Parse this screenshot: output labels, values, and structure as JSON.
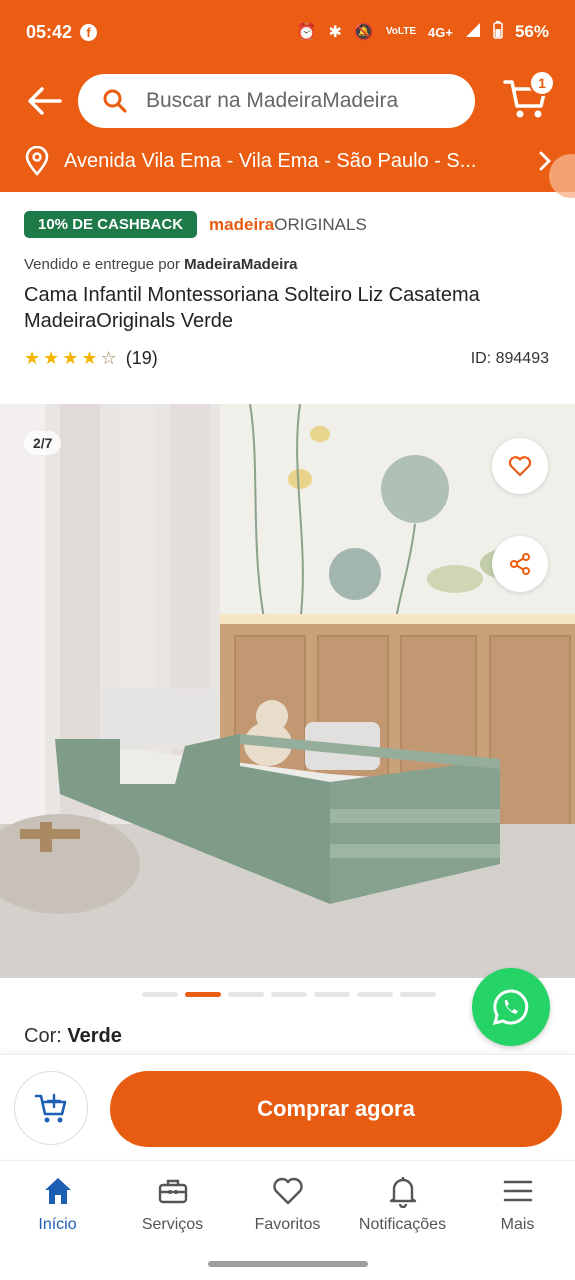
{
  "status_bar": {
    "time": "05:42",
    "network": "4G+",
    "volte": "VoLTE",
    "battery": "56%"
  },
  "search": {
    "placeholder": "Buscar na MadeiraMadeira"
  },
  "cart": {
    "count": "1"
  },
  "address": {
    "text": "Avenida Vila Ema - Vila Ema - São Paulo - S..."
  },
  "product": {
    "cashback_badge": "10% DE CASHBACK",
    "brand_bold": "madeira",
    "brand_rest": "ORIGINALS",
    "seller_prefix": "Vendido e entregue por ",
    "seller_name": "MadeiraMadeira",
    "title": "Cama Infantil Montessoriana Solteiro Liz Casatema MadeiraOriginals Verde",
    "rating": 4,
    "rating_max": 5,
    "rating_count": "(19)",
    "id_label": "ID: 894493",
    "color_label": "Cor: ",
    "color_value": "Verde"
  },
  "gallery": {
    "counter": "2/7",
    "current_index": 2,
    "total": 7
  },
  "actions": {
    "buy_label": "Comprar agora"
  },
  "nav": {
    "items": [
      {
        "label": "Início",
        "icon": "home-icon",
        "active": true
      },
      {
        "label": "Serviços",
        "icon": "toolbox-icon",
        "active": false
      },
      {
        "label": "Favoritos",
        "icon": "heart-icon",
        "active": false
      },
      {
        "label": "Notificações",
        "icon": "bell-icon",
        "active": false
      },
      {
        "label": "Mais",
        "icon": "menu-icon",
        "active": false
      }
    ]
  },
  "colors": {
    "brand_orange": "#ea5d12",
    "cashback_green": "#1f7a4a",
    "nav_active_blue": "#1d5fb3",
    "whatsapp_green": "#25d366"
  }
}
